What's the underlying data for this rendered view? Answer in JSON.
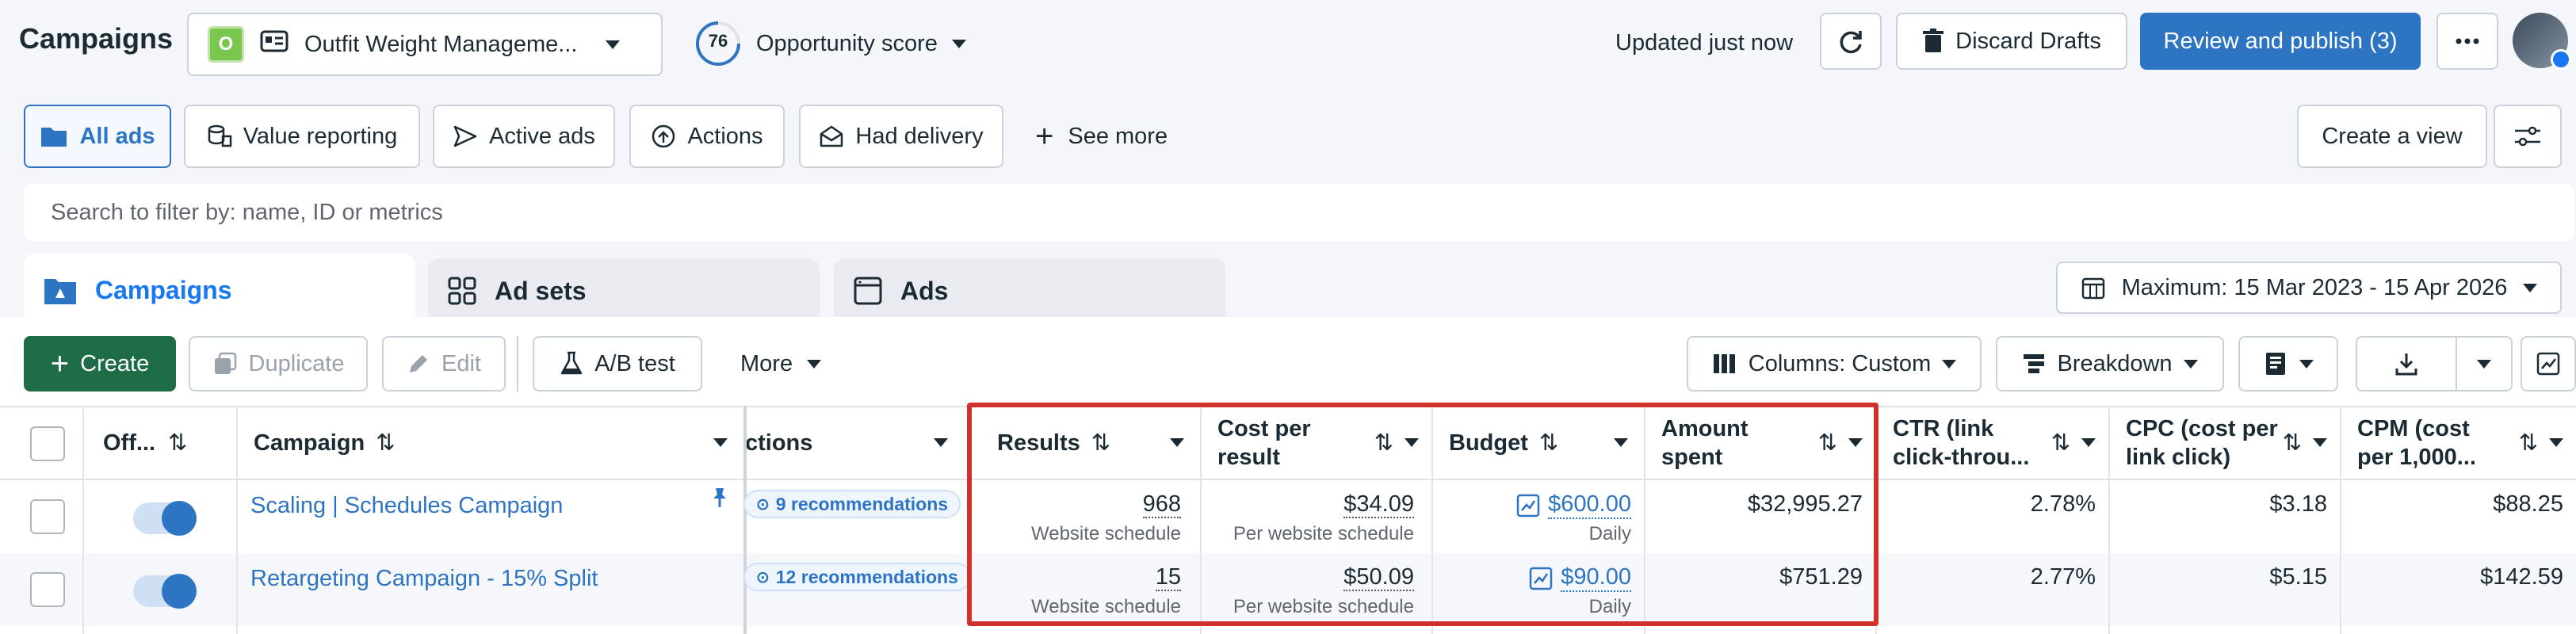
{
  "header": {
    "title": "Campaigns",
    "account_name": "Outfit Weight Manageme...",
    "account_badge": "O",
    "opportunity_score_value": "76",
    "opportunity_score_label": "Opportunity score",
    "updated_text": "Updated just now",
    "discard_label": "Discard Drafts",
    "review_label": "Review and publish (3)",
    "more_label": "⋯"
  },
  "filters": {
    "chips": [
      "All ads",
      "Value reporting",
      "Active ads",
      "Actions",
      "Had delivery"
    ],
    "see_more": "See more",
    "create_view": "Create a view",
    "search_placeholder": "Search to filter by: name, ID or metrics"
  },
  "tabs": {
    "campaigns": "Campaigns",
    "ad_sets": "Ad sets",
    "ads": "Ads",
    "date_range": "Maximum: 15 Mar 2023 - 15 Apr 2026"
  },
  "toolbar": {
    "create": "Create",
    "duplicate": "Duplicate",
    "edit": "Edit",
    "ab_test": "A/B test",
    "more": "More",
    "columns": "Columns: Custom",
    "breakdown": "Breakdown"
  },
  "table": {
    "headers": {
      "offon": "Off...",
      "campaign": "Campaign",
      "actions": "ctions",
      "results": "Results",
      "cost_per_result_1": "Cost per",
      "cost_per_result_2": "result",
      "budget": "Budget",
      "amount_spent_1": "Amount",
      "amount_spent_2": "spent",
      "ctr_1": "CTR (link",
      "ctr_2": "click-throu...",
      "cpc_1": "CPC (cost per",
      "cpc_2": "link click)",
      "cpm_1": "CPM (cost",
      "cpm_2": "per 1,000..."
    },
    "rows": [
      {
        "campaign": "Scaling | Schedules Campaign",
        "recommendations": "9 recommendations",
        "results": "968",
        "results_sub": "Website schedule",
        "cost_per_result": "$34.09",
        "cost_sub": "Per website schedule",
        "budget": "$600.00",
        "budget_sub": "Daily",
        "amount_spent": "$32,995.27",
        "ctr": "2.78%",
        "cpc": "$3.18",
        "cpm": "$88.25"
      },
      {
        "campaign": "Retargeting Campaign - 15% Split",
        "recommendations": "12 recommendations",
        "results": "15",
        "results_sub": "Website schedule",
        "cost_per_result": "$50.09",
        "cost_sub": "Per website schedule",
        "budget": "$90.00",
        "budget_sub": "Daily",
        "amount_spent": "$751.29",
        "ctr": "2.77%",
        "cpc": "$5.15",
        "cpm": "$142.59"
      }
    ]
  },
  "colors": {
    "accent": "#2d74c3",
    "create_green": "#1e6b47",
    "highlight_red": "#d0312d"
  }
}
